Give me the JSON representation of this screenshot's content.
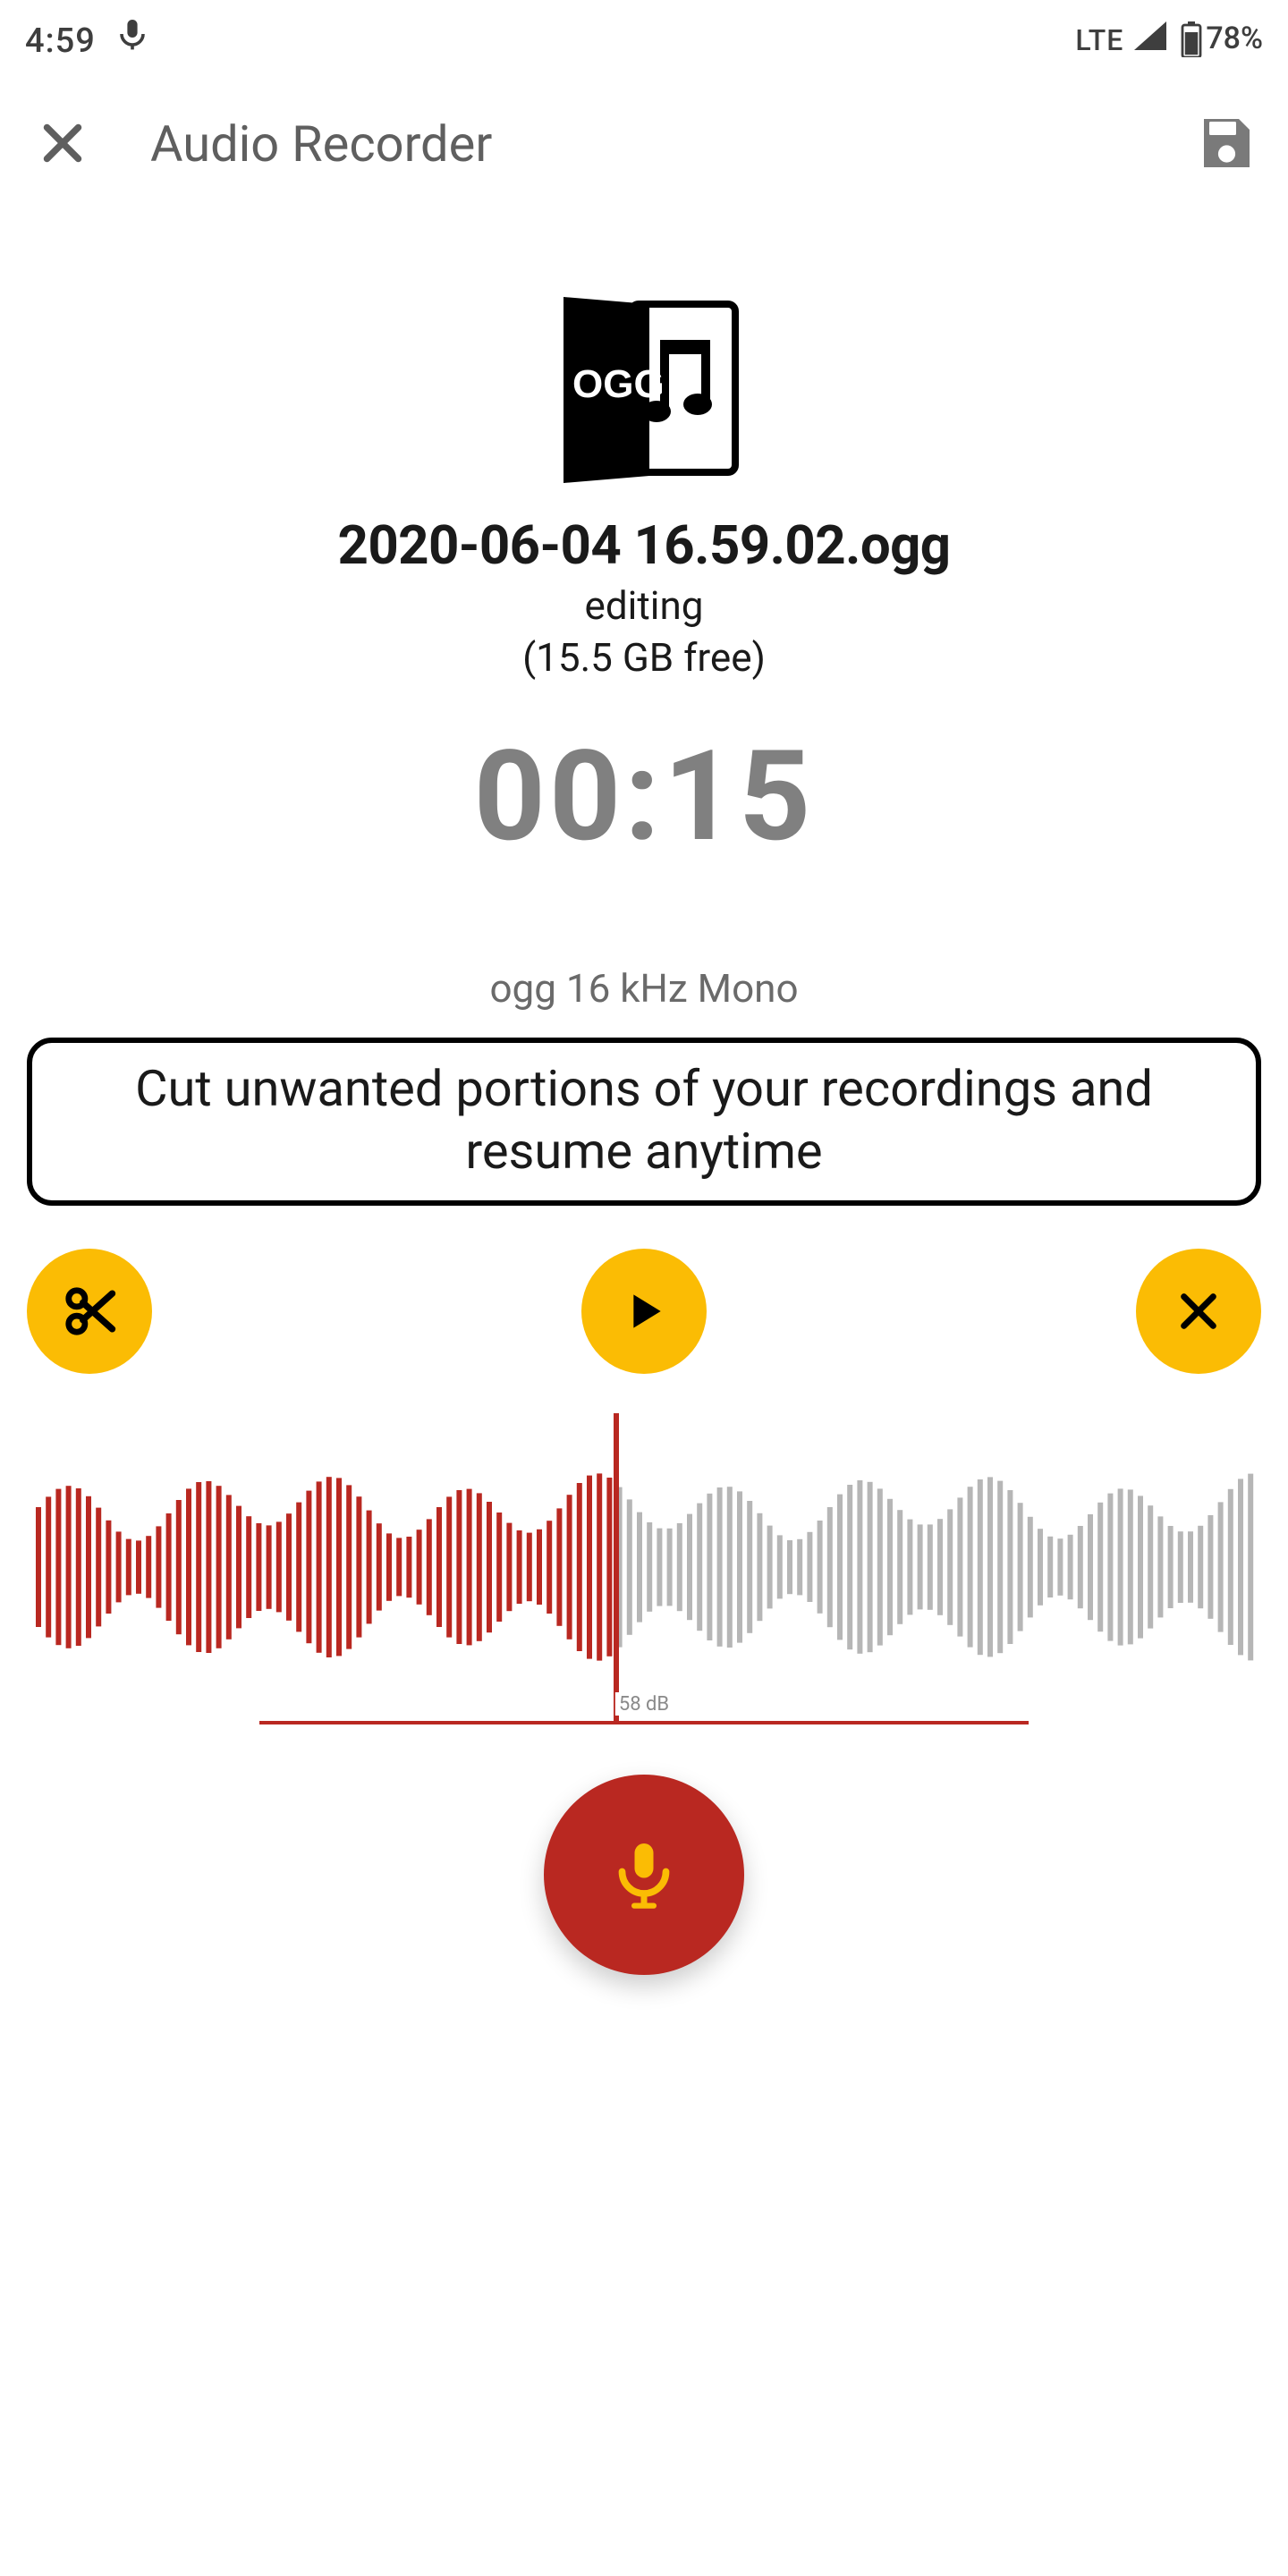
{
  "status": {
    "time": "4:59",
    "lte": "LTE",
    "battery_pct": "78%"
  },
  "header": {
    "title": "Audio Recorder",
    "close_icon": "close-icon",
    "save_icon": "save-floppy-icon"
  },
  "file": {
    "format_badge": "OGG",
    "name": "2020-06-04 16.59.02.ogg",
    "status": "editing",
    "free_space": "(15.5 GB free)"
  },
  "timer": "00:15",
  "format_line": "ogg 16 kHz Mono",
  "tip": "Cut unwanted portions of your recordings and resume anytime",
  "controls": {
    "cut_icon": "scissors-icon",
    "play_icon": "play-icon",
    "close_icon": "close-icon"
  },
  "waveform": {
    "playhead_position_ratio": 0.475,
    "db_label": "58 dB"
  },
  "record": {
    "mic_icon": "microphone-icon"
  },
  "colors": {
    "accent_yellow": "#fbbc04",
    "accent_red": "#b92821",
    "text_gray": "#5f5f5f"
  }
}
